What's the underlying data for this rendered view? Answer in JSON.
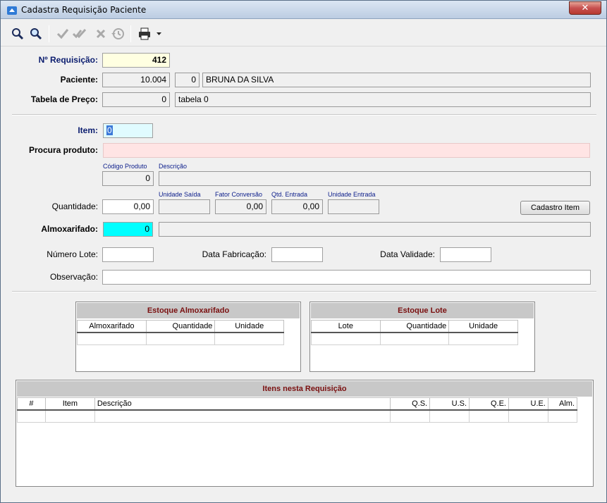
{
  "window": {
    "title": "Cadastra Requisição Paciente",
    "close": "✕"
  },
  "toolbar": {
    "icons": [
      "search-icon",
      "search-plus-icon",
      "check-icon",
      "check-double-icon",
      "cancel-icon",
      "history-icon",
      "printer-icon",
      "dropdown-icon"
    ]
  },
  "header": {
    "requisicao_label": "Nº Requisição:",
    "requisicao_value": "412",
    "paciente_label": "Paciente:",
    "paciente_code": "10.004",
    "paciente_seq": "0",
    "paciente_name": "BRUNA DA SILVA",
    "tabela_label": "Tabela de Preço:",
    "tabela_code": "0",
    "tabela_name": "tabela 0"
  },
  "item": {
    "item_label": "Item:",
    "item_value": "0",
    "procura_label": "Procura produto:",
    "procura_value": "",
    "codigo_caption": "Código Produto",
    "codigo_value": "0",
    "descricao_caption": "Descrição",
    "descricao_value": "",
    "quantidade_label": "Quantidade:",
    "quantidade_value": "0,00",
    "unidade_saida_caption": "Unidade Saída",
    "unidade_saida_value": "",
    "fator_caption": "Fator Conversão",
    "fator_value": "0,00",
    "qtd_entrada_caption": "Qtd. Entrada",
    "qtd_entrada_value": "0,00",
    "unidade_entrada_caption": "Unidade Entrada",
    "unidade_entrada_value": "",
    "cadastro_button": "Cadastro Item",
    "almox_label": "Almoxarifado:",
    "almox_value": "0",
    "almox_name": "",
    "lote_label": "Número Lote:",
    "lote_value": "",
    "fabricacao_label": "Data Fabricação:",
    "fabricacao_value": "",
    "validade_label": "Data Validade:",
    "validade_value": "",
    "observacao_label": "Observação:",
    "observacao_value": ""
  },
  "estoque_almox": {
    "title": "Estoque Almoxarifado",
    "columns": [
      "Almoxarifado",
      "Quantidade",
      "Unidade"
    ]
  },
  "estoque_lote": {
    "title": "Estoque Lote",
    "columns": [
      "Lote",
      "Quantidade",
      "Unidade"
    ]
  },
  "itens": {
    "title": "Itens nesta Requisição",
    "columns": [
      "#",
      "Item",
      "Descrição",
      "Q.S.",
      "U.S.",
      "Q.E.",
      "U.E.",
      "Alm."
    ]
  },
  "colors": {
    "accent_header": "#7a1010",
    "label_navy": "#0a1c6e",
    "almox_cyan": "#00ffff",
    "search_pink": "#ffe4e4",
    "req_yellow": "#ffffe1"
  }
}
